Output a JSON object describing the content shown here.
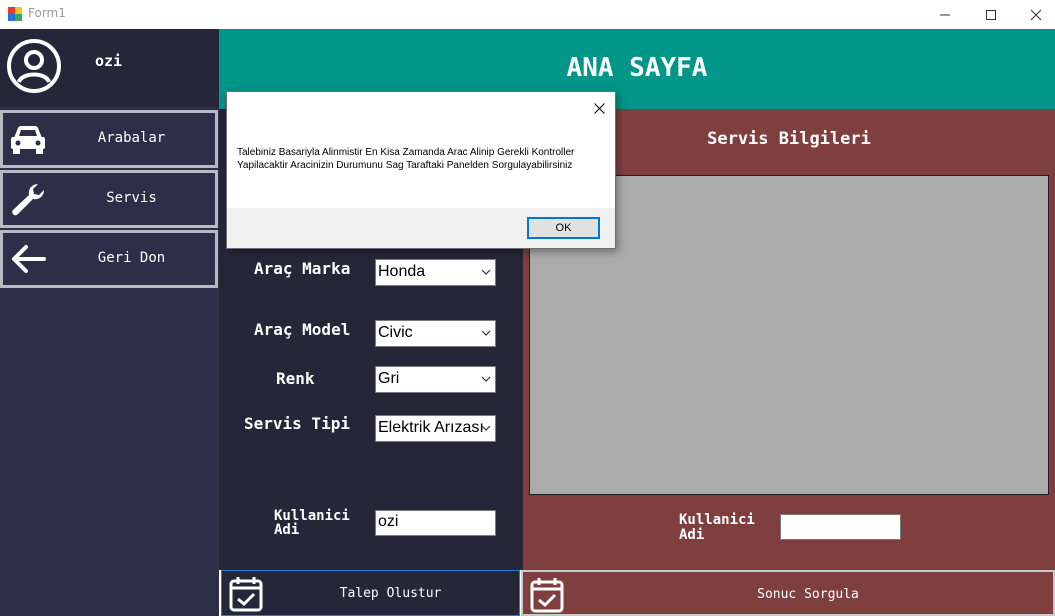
{
  "window": {
    "title": "Form1",
    "minimize_glyph": "—",
    "maximize_glyph": "☐",
    "close_glyph": "✕"
  },
  "sidebar": {
    "username": "ozi",
    "items": [
      {
        "label": "Arabalar",
        "icon": "car-icon"
      },
      {
        "label": "Servis",
        "icon": "wrench-icon"
      },
      {
        "label": "Geri Don",
        "icon": "arrow-left-icon"
      }
    ]
  },
  "header": {
    "title": "ANA SAYFA"
  },
  "form": {
    "brand_label": "Araç Marka",
    "brand_value": "Honda",
    "model_label": "Araç Model",
    "model_value": "Civic",
    "color_label": "Renk",
    "color_value": "Gri",
    "service_type_label": "Servis Tipi",
    "service_type_value": "Elektrik Arızası",
    "username_label_line1": "Kullanici",
    "username_label_line2": "Adi",
    "username_value": "ozi"
  },
  "service_panel": {
    "title": "Servis Bilgileri",
    "username_label_line1": "Kullanici",
    "username_label_line2": "Adi",
    "username_value": ""
  },
  "buttons": {
    "create_request": "Talep Olustur",
    "query_result": "Sonuc Sorgula"
  },
  "dialog": {
    "message": "Talebiniz Basariyla Alinmistir En Kisa Zamanda Arac Alinip Gerekli Kontroller Yapilacaktir Aracinizin Durumunu Sag Taraftaki Panelden Sorgulayabilirsiniz",
    "ok_label": "OK"
  },
  "colors": {
    "header": "#009688",
    "sidebar": "#2e2e48",
    "form_panel": "#262638",
    "service_panel": "#7f3f3f",
    "service_box": "#ababab"
  }
}
